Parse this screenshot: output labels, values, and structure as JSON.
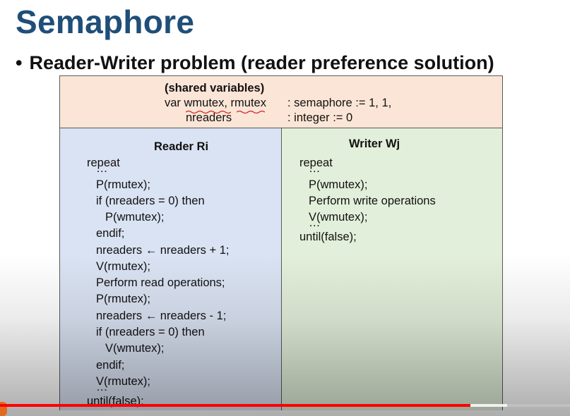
{
  "slide": {
    "title": "Semaphore",
    "bullet": "Reader-Writer problem (reader preference solution)"
  },
  "shared": {
    "heading": "(shared variables)",
    "var_keyword": "var ",
    "var_names": "wmutex, rmutex",
    "var_type": ": semaphore := 1, 1,",
    "nreaders": "nreaders",
    "nreaders_type": ": integer := 0"
  },
  "reader": {
    "heading": "Reader Ri",
    "lines": [
      "repeat",
      "…",
      "P(rmutex);",
      "if (nreaders = 0) then",
      "P(wmutex);",
      "endif;",
      "nreaders ← nreaders + 1;",
      "V(rmutex);",
      "Perform read operations;",
      "P(rmutex);",
      "nreaders ← nreaders - 1;",
      "if (nreaders = 0) then",
      "V(wmutex);",
      "endif;",
      "V(rmutex);",
      "…",
      "until(false);"
    ]
  },
  "writer": {
    "heading": "Writer Wj",
    "lines": [
      "repeat",
      "…",
      "P(wmutex);",
      "Perform write operations",
      "V(wmutex);",
      "…",
      "until(false);"
    ]
  },
  "player": {
    "progress_fraction": 0.825,
    "buffer_fraction": 0.89,
    "accent_color": "#ff0000"
  }
}
